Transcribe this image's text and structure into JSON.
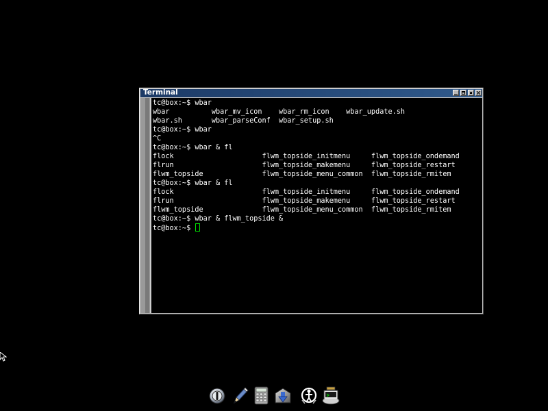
{
  "window": {
    "title": "Terminal"
  },
  "terminal": {
    "lines": [
      "tc@box:~$ wbar",
      "wbar          wbar_mv_icon    wbar_rm_icon    wbar_update.sh",
      "wbar.sh       wbar_parseConf  wbar_setup.sh",
      "tc@box:~$ wbar",
      "^C",
      "tc@box:~$ wbar & fl",
      "flock                     flwm_topside_initmenu     flwm_topside_ondemand",
      "flrun                     flwm_topside_makemenu     flwm_topside_restart",
      "flwm_topside              flwm_topside_menu_common  flwm_topside_rmitem",
      "tc@box:~$ wbar & fl",
      "flock                     flwm_topside_initmenu     flwm_topside_ondemand",
      "flrun                     flwm_topside_makemenu     flwm_topside_restart",
      "flwm_topside              flwm_topside_menu_common  flwm_topside_rmitem",
      "tc@box:~$ wbar & flwm_topside &"
    ],
    "prompt": "tc@box:~$ ",
    "cursor_color": "#00e000",
    "text_color": "#ffffff",
    "background": "#000000"
  },
  "dock": {
    "icons": [
      "power-icon",
      "pen-icon",
      "calculator-icon",
      "download-icon",
      "network-icon",
      "terminal-app-icon"
    ]
  },
  "colors": {
    "desktop": "#000000",
    "titlebar": "#1c3a66",
    "window_frame": "#c0c0c0"
  }
}
